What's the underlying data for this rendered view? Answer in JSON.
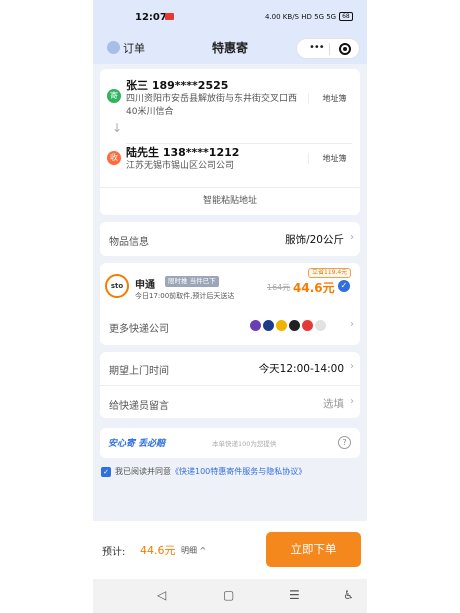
{
  "status": {
    "time": "12:07",
    "signal": "4.00 KB/S HD 5G 5G",
    "battery": "68"
  },
  "nav": {
    "order_label": "订单",
    "title": "特惠寄",
    "menu_icon": "more-dots-icon",
    "close_icon": "target-icon"
  },
  "sender": {
    "badge": "寄",
    "name": "张三 189****2525",
    "address": "四川资阳市安岳县解放街与东井街交叉口西40米川信合",
    "book_label": "地址簿"
  },
  "receiver": {
    "badge": "收",
    "name": "陆先生 138****1212",
    "address": "江苏无锡市锡山区公司公司",
    "book_label": "地址簿"
  },
  "smart_paste": "智能粘贴地址",
  "goods": {
    "label": "物品信息",
    "value": "服饰/20公斤"
  },
  "courier": {
    "logo": "sto",
    "name": "申通",
    "tag": "限时推 当件已下",
    "desc": "今日17:00前取件,预计后天送达",
    "save_badge": "立省119.4元",
    "old_price": "164元",
    "new_price": "44.6元"
  },
  "more_courier": {
    "label": "更多快递公司",
    "logo_colors": [
      "#6a3fb0",
      "#1e3c8c",
      "#f0b400",
      "#222222",
      "#e53935",
      "#e2e2e2"
    ]
  },
  "pickup_time": {
    "label": "期望上门时间",
    "value": "今天12:00-14:00"
  },
  "message": {
    "label": "给快递员留言",
    "value": "选填"
  },
  "safe": {
    "logo": "安心寄 丢必赔",
    "text": "本单快递100为您提供"
  },
  "agreement": {
    "prefix": "我已阅读并同意",
    "link": "《快递100特惠寄件服务与隐私协议》"
  },
  "bottom": {
    "estimate_label": "预计:",
    "estimate_price": "44.6元",
    "detail_label": "明细",
    "order_button": "立即下单"
  },
  "colors": {
    "accent": "#f4881c",
    "link": "#2f6fe0",
    "sender_badge": "#2fb35c",
    "receiver_badge": "#ff6b3d"
  }
}
